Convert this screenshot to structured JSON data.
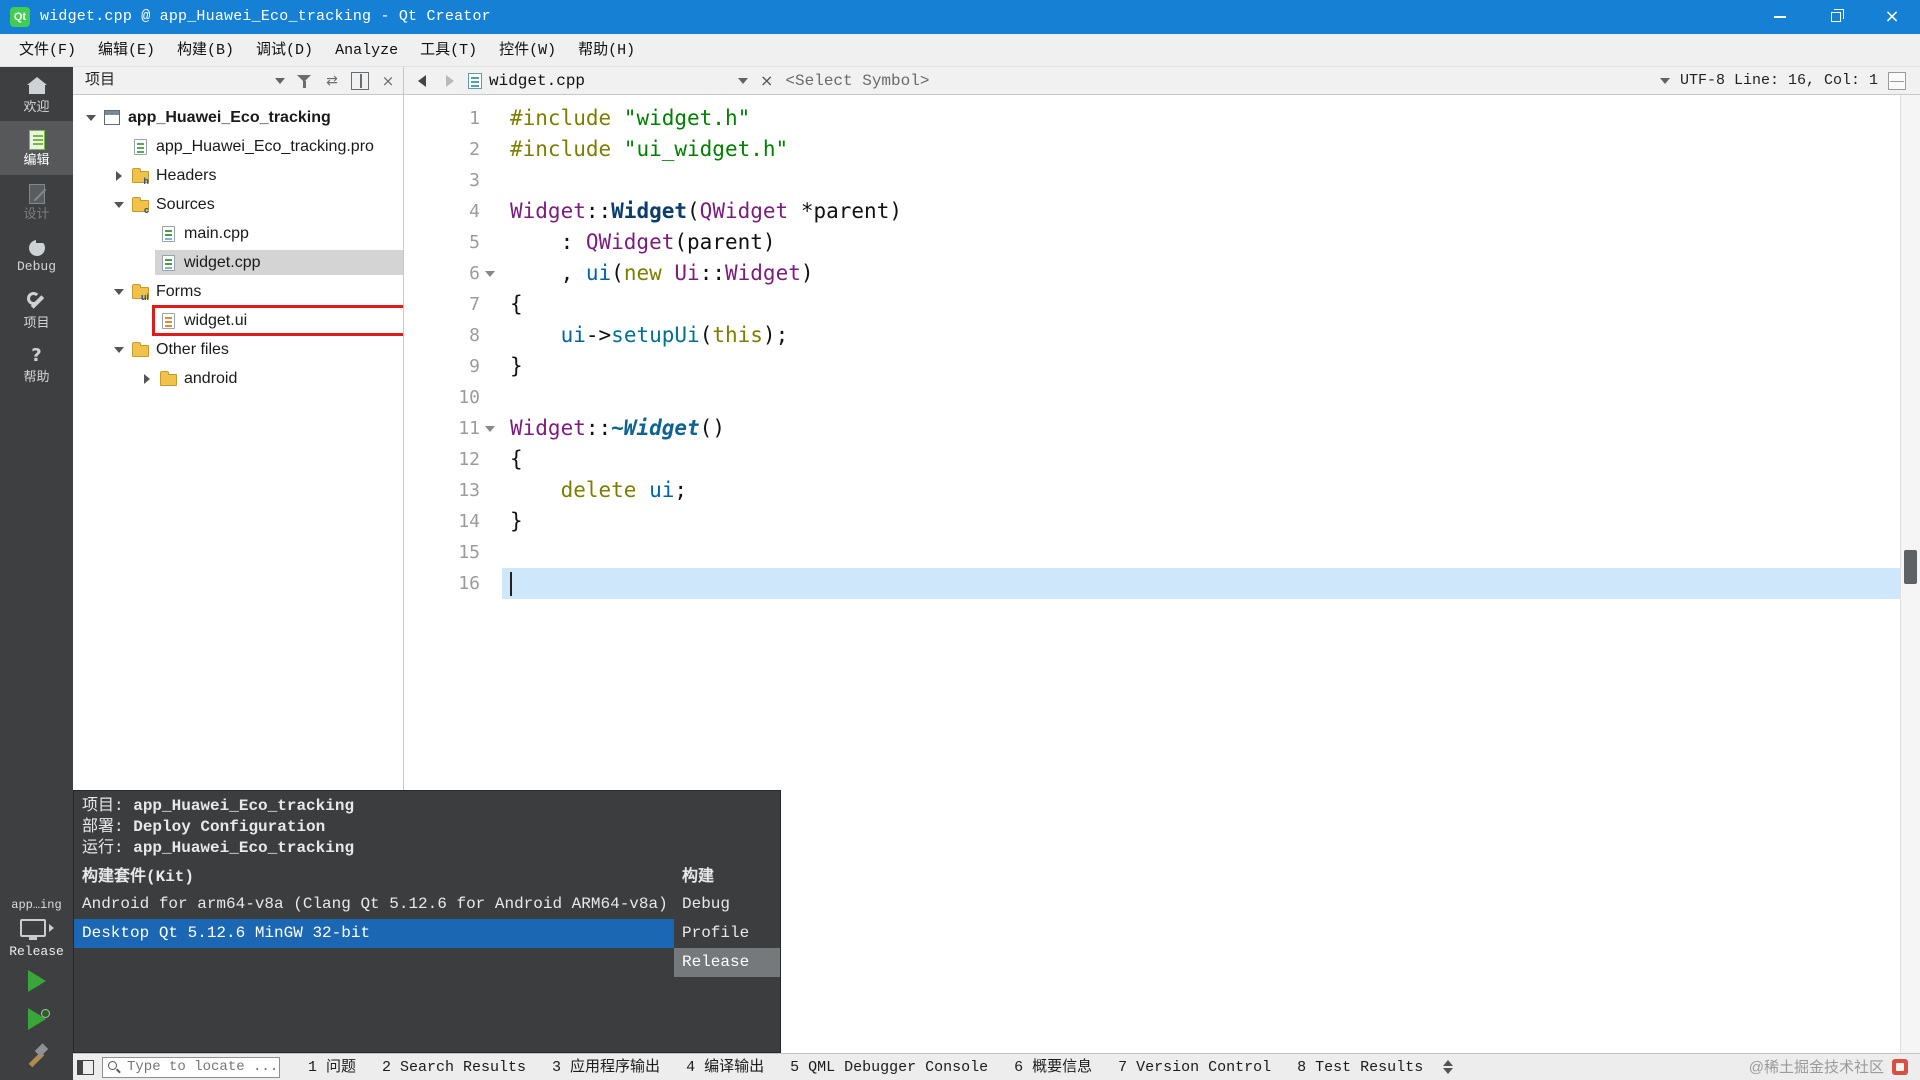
{
  "window": {
    "title": "widget.cpp @ app_Huawei_Eco_tracking - Qt Creator",
    "app_icon": "Qt"
  },
  "menu": {
    "items": [
      "文件(F)",
      "编辑(E)",
      "构建(B)",
      "调试(D)",
      "Analyze",
      "工具(T)",
      "控件(W)",
      "帮助(H)"
    ]
  },
  "mode_sidebar": {
    "items": [
      {
        "label": "欢迎",
        "icon": "welcome-icon",
        "state": "normal"
      },
      {
        "label": "编辑",
        "icon": "edit-icon",
        "state": "selected"
      },
      {
        "label": "设计",
        "icon": "design-icon",
        "state": "disabled"
      },
      {
        "label": "Debug",
        "icon": "debug-icon",
        "state": "normal"
      },
      {
        "label": "项目",
        "icon": "projects-icon",
        "state": "normal"
      },
      {
        "label": "帮助",
        "icon": "help-icon",
        "state": "normal"
      }
    ],
    "target": {
      "project": "app…ing",
      "config": "Release"
    }
  },
  "project_pane": {
    "header": "项目",
    "tree": [
      {
        "label": "app_Huawei_Eco_tracking",
        "level": 0,
        "caret": "expanded",
        "icon": "project-icon",
        "bold": true
      },
      {
        "label": "app_Huawei_Eco_tracking.pro",
        "level": 1,
        "caret": null,
        "icon": "pro-file-icon"
      },
      {
        "label": "Headers",
        "level": 1,
        "caret": "collapsed",
        "icon": "headers-folder-icon",
        "badge": "h"
      },
      {
        "label": "Sources",
        "level": 1,
        "caret": "expanded",
        "icon": "sources-folder-icon",
        "badge": "c"
      },
      {
        "label": "main.cpp",
        "level": 2,
        "caret": null,
        "icon": "cpp-file-icon"
      },
      {
        "label": "widget.cpp",
        "level": 2,
        "caret": null,
        "icon": "cpp-file-icon",
        "selected": true
      },
      {
        "label": "Forms",
        "level": 1,
        "caret": "expanded",
        "icon": "forms-folder-icon",
        "badge": "ui"
      },
      {
        "label": "widget.ui",
        "level": 2,
        "caret": null,
        "icon": "ui-file-icon",
        "annotated": true
      },
      {
        "label": "Other files",
        "level": 1,
        "caret": "expanded",
        "icon": "folder-icon"
      },
      {
        "label": "android",
        "level": 2,
        "caret": "collapsed",
        "icon": "folder-icon"
      }
    ]
  },
  "editor": {
    "tab_label": "widget.cpp",
    "symbol_selector": "<Select Symbol>",
    "encoding_status": "UTF-8 Line: 16, Col: 1",
    "code": [
      {
        "n": 1,
        "tokens": [
          {
            "t": "#include ",
            "c": "pp"
          },
          {
            "t": "\"widget.h\"",
            "c": "str"
          }
        ]
      },
      {
        "n": 2,
        "tokens": [
          {
            "t": "#include ",
            "c": "pp"
          },
          {
            "t": "\"ui_widget.h\"",
            "c": "str"
          }
        ]
      },
      {
        "n": 3,
        "tokens": []
      },
      {
        "n": 4,
        "tokens": [
          {
            "t": "Widget",
            "c": "type"
          },
          {
            "t": "::",
            "c": "pln"
          },
          {
            "t": "Widget",
            "c": "fdecl"
          },
          {
            "t": "(",
            "c": "pln"
          },
          {
            "t": "QWidget",
            "c": "type"
          },
          {
            "t": " *parent)",
            "c": "pln"
          }
        ]
      },
      {
        "n": 5,
        "tokens": [
          {
            "t": "    : ",
            "c": "pln"
          },
          {
            "t": "QWidget",
            "c": "type"
          },
          {
            "t": "(parent)",
            "c": "pln"
          }
        ]
      },
      {
        "n": 6,
        "fold": true,
        "tokens": [
          {
            "t": "    , ",
            "c": "pln"
          },
          {
            "t": "ui",
            "c": "mem"
          },
          {
            "t": "(",
            "c": "pln"
          },
          {
            "t": "new",
            "c": "kw"
          },
          {
            "t": " ",
            "c": "pln"
          },
          {
            "t": "Ui",
            "c": "type"
          },
          {
            "t": "::",
            "c": "pln"
          },
          {
            "t": "Widget",
            "c": "type"
          },
          {
            "t": ")",
            "c": "pln"
          }
        ]
      },
      {
        "n": 7,
        "tokens": [
          {
            "t": "{",
            "c": "pln"
          }
        ]
      },
      {
        "n": 8,
        "tokens": [
          {
            "t": "    ",
            "c": "pln"
          },
          {
            "t": "ui",
            "c": "mem"
          },
          {
            "t": "->",
            "c": "pln"
          },
          {
            "t": "setupUi",
            "c": "fn"
          },
          {
            "t": "(",
            "c": "pln"
          },
          {
            "t": "this",
            "c": "kw"
          },
          {
            "t": ");",
            "c": "pln"
          }
        ]
      },
      {
        "n": 9,
        "tokens": [
          {
            "t": "}",
            "c": "pln"
          }
        ]
      },
      {
        "n": 10,
        "tokens": []
      },
      {
        "n": 11,
        "fold": true,
        "tokens": [
          {
            "t": "Widget",
            "c": "type"
          },
          {
            "t": "::",
            "c": "pln"
          },
          {
            "t": "~Widget",
            "c": "vdecl"
          },
          {
            "t": "()",
            "c": "pln"
          }
        ]
      },
      {
        "n": 12,
        "tokens": [
          {
            "t": "{",
            "c": "pln"
          }
        ]
      },
      {
        "n": 13,
        "tokens": [
          {
            "t": "    ",
            "c": "pln"
          },
          {
            "t": "delete",
            "c": "kw"
          },
          {
            "t": " ",
            "c": "pln"
          },
          {
            "t": "ui",
            "c": "mem"
          },
          {
            "t": ";",
            "c": "pln"
          }
        ]
      },
      {
        "n": 14,
        "tokens": [
          {
            "t": "}",
            "c": "pln"
          }
        ]
      },
      {
        "n": 15,
        "tokens": []
      },
      {
        "n": 16,
        "current": true,
        "tokens": []
      }
    ]
  },
  "kit_popup": {
    "info": [
      {
        "label": "项目:",
        "value": "app_Huawei_Eco_tracking"
      },
      {
        "label": "部署:",
        "value": "Deploy Configuration"
      },
      {
        "label": "运行:",
        "value": "app_Huawei_Eco_tracking"
      }
    ],
    "kit_header": "构建套件(Kit)",
    "build_header": "构建",
    "kits": [
      {
        "label": "Android for arm64-v8a (Clang Qt 5.12.6 for Android ARM64-v8a)",
        "selected": false
      },
      {
        "label": "Desktop Qt 5.12.6 MinGW 32-bit",
        "selected": true
      }
    ],
    "builds": [
      {
        "label": "Debug",
        "selected": false
      },
      {
        "label": "Profile",
        "selected": false
      },
      {
        "label": "Release",
        "selected": true
      }
    ]
  },
  "status_bar": {
    "locator_placeholder": "Type to locate ...",
    "panels": [
      "1 问题",
      "2 Search Results",
      "3 应用程序输出",
      "4 编译输出",
      "5 QML Debugger Console",
      "6 概要信息",
      "7 Version Control",
      "8 Test Results"
    ]
  },
  "watermark": "@稀土掘金技术社区",
  "colors": {
    "titlebar": "#1580d4",
    "selection_blue": "#1b67b4",
    "inactive_selection_gray": "#75797c",
    "current_line": "#cfe7fa",
    "annotation_red": "#e01b1b",
    "sidebar_dark": "#3d3f41"
  }
}
